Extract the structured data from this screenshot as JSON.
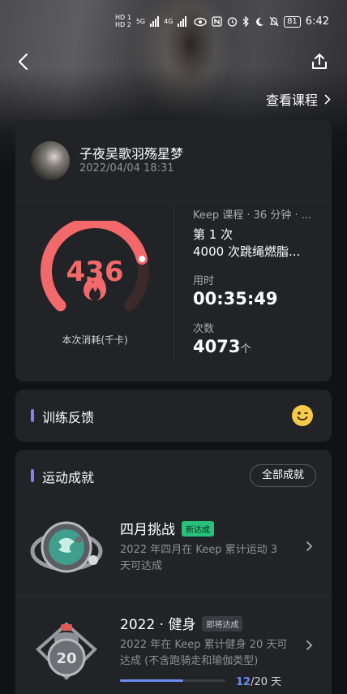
{
  "status_bar": {
    "hd1": "HD 1",
    "hd2": "HD 2",
    "net": "5G",
    "net2": "4G",
    "battery": "81",
    "time": "6:42"
  },
  "header": {
    "view_course": "查看课程"
  },
  "workout": {
    "user_name": "子夜吴歌羽殇星梦",
    "date": "2022/04/04 18:31",
    "calories": "436",
    "calories_label": "本次消耗(千卡)",
    "calorie_ring_fraction": 0.78,
    "course_meta": "Keep 课程 · 36 分钟 · ...",
    "course_times": "第 1 次",
    "course_name": "4000 次跳绳燃脂...",
    "duration_label": "用时",
    "duration": "00:35:49",
    "count_label": "次数",
    "count": "4073",
    "count_unit": "个"
  },
  "feedback": {
    "title": "训练反馈"
  },
  "achievements": {
    "title": "运动成就",
    "all_button": "全部成就",
    "items": [
      {
        "title": "四月挑战",
        "tag": "新达成",
        "desc": "2022 年四月在 Keep 累计运动 3 天可达成"
      },
      {
        "title": "2022 · 健身",
        "tag": "即将达成",
        "desc": "2022 年在 Keep 累计健身 20 天可达成 (不含跑骑走和瑜伽类型)",
        "progress_current": "12",
        "progress_total": "/20 天",
        "progress_fraction": 0.6,
        "medal_number": "20"
      }
    ]
  },
  "colors": {
    "accent_ring": "#f3686a",
    "section_bar": "#8a7ff0",
    "tag_new": "#27c17a",
    "progress": "#6c8cf0"
  }
}
